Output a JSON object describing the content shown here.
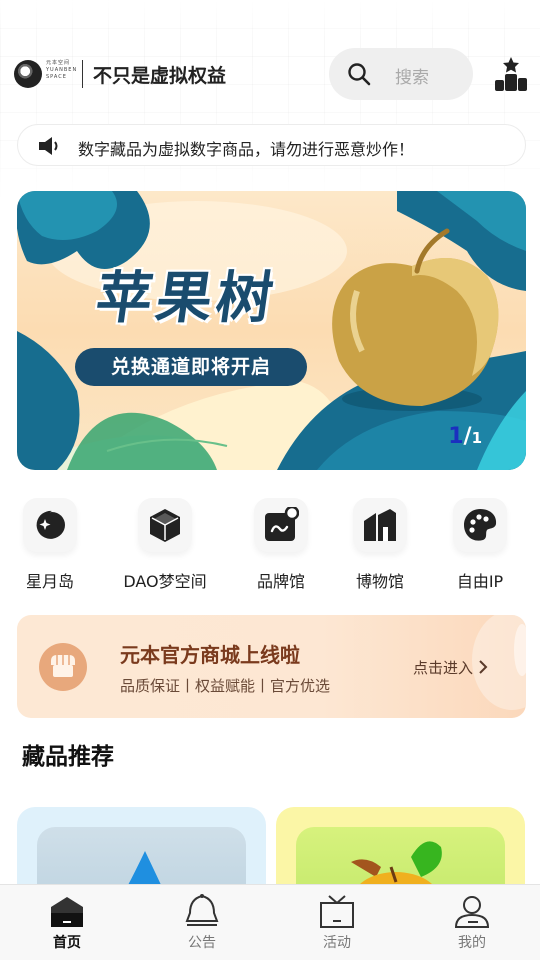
{
  "header": {
    "brand_slogan": "不只是虚拟权益",
    "logo_text": "元本空间 YUANBEN SPACE",
    "search_placeholder": "搜索"
  },
  "notice": {
    "text": "数字藏品为虚拟数字商品，请勿进行恶意炒作！"
  },
  "banner": {
    "title": "苹果树",
    "subtitle": "兑换通道即将开启",
    "page_current": "1",
    "page_total": "1"
  },
  "categories": [
    {
      "label": "星月岛",
      "icon": "moon-star-icon"
    },
    {
      "label": "DAO梦空间",
      "icon": "cube-icon"
    },
    {
      "label": "品牌馆",
      "icon": "brand-icon"
    },
    {
      "label": "博物馆",
      "icon": "museum-icon"
    },
    {
      "label": "自由IP",
      "icon": "palette-icon"
    }
  ],
  "promo": {
    "title": "元本官方商城上线啦",
    "subtitle": "品质保证丨权益赋能丨官方优选",
    "link": "点击进入"
  },
  "section": {
    "title": "藏品推荐"
  },
  "tabs": [
    {
      "label": "首页",
      "icon": "home-icon",
      "active": true
    },
    {
      "label": "公告",
      "icon": "bell-icon",
      "active": false
    },
    {
      "label": "活动",
      "icon": "gift-icon",
      "active": false
    },
    {
      "label": "我的",
      "icon": "user-icon",
      "active": false
    }
  ]
}
